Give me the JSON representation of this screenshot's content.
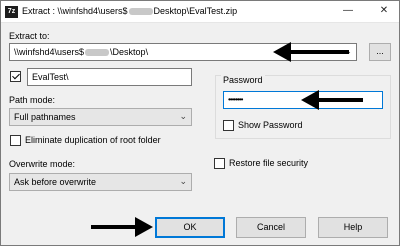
{
  "window": {
    "title_prefix": "Extract : \\\\winfshd4\\users$",
    "title_suffix": "Desktop\\EvalTest.zip",
    "app_icon": "7z",
    "minimize_glyph": "—",
    "close_glyph": "✕"
  },
  "extract_to": {
    "label": "Extract to:",
    "path_prefix": "\\\\winfshd4\\users$",
    "path_suffix": "\\Desktop\\",
    "browse_label": "..."
  },
  "folder_name": {
    "value": "EvalTest\\",
    "checked": true
  },
  "path_mode": {
    "label": "Path mode:",
    "value": "Full pathnames"
  },
  "eliminate_dup": {
    "label": "Eliminate duplication of root folder",
    "checked": false
  },
  "overwrite_mode": {
    "label": "Overwrite mode:",
    "value": "Ask before overwrite"
  },
  "password": {
    "group_label": "Password",
    "value": "••••••••",
    "show_label": "Show Password",
    "show_checked": false
  },
  "restore_security": {
    "label": "Restore file security",
    "checked": false
  },
  "buttons": {
    "ok": "OK",
    "cancel": "Cancel",
    "help": "Help"
  },
  "colors": {
    "accent": "#0078d7",
    "arrow": "#000000"
  }
}
